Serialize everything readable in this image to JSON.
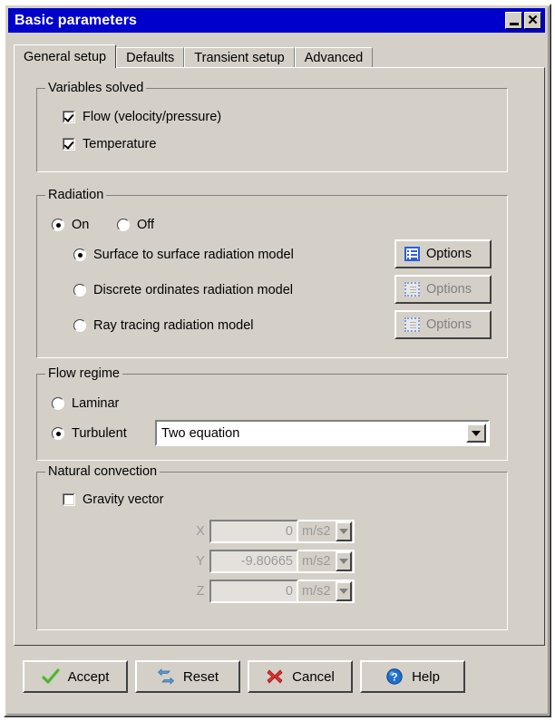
{
  "window": {
    "title": "Basic parameters",
    "minimize_label": "Minimize",
    "close_label": "Close",
    "minimize_icon": "minimize-icon",
    "close_icon": "close-icon",
    "titlebar_color": "#0000cc",
    "face_color": "#d4d0c8"
  },
  "tabs": [
    {
      "label": "General setup",
      "active": true
    },
    {
      "label": "Defaults",
      "active": false
    },
    {
      "label": "Transient setup",
      "active": false
    },
    {
      "label": "Advanced",
      "active": false
    }
  ],
  "variables_solved": {
    "legend": "Variables solved",
    "items": [
      {
        "label": "Flow (velocity/pressure)",
        "checked": true
      },
      {
        "label": "Temperature",
        "checked": true
      }
    ]
  },
  "radiation": {
    "legend": "Radiation",
    "toggle": [
      {
        "label": "On",
        "selected": true
      },
      {
        "label": "Off",
        "selected": false
      }
    ],
    "models": [
      {
        "label": "Surface to surface radiation model",
        "selected": true,
        "options_label": "Options",
        "options_enabled": true,
        "options_icon": "list-options-icon"
      },
      {
        "label": "Discrete ordinates radiation model",
        "selected": false,
        "options_label": "Options",
        "options_enabled": false,
        "options_icon": "grid-options-icon"
      },
      {
        "label": "Ray tracing radiation model",
        "selected": false,
        "options_label": "Options",
        "options_enabled": false,
        "options_icon": "grid-options-icon"
      }
    ]
  },
  "flow_regime": {
    "legend": "Flow regime",
    "options": [
      {
        "label": "Laminar",
        "selected": false
      },
      {
        "label": "Turbulent",
        "selected": true
      }
    ],
    "turbulence_model": {
      "value": "Two equation",
      "arrow_icon": "chevron-down-icon"
    }
  },
  "natural_convection": {
    "legend": "Natural convection",
    "gravity_vector": {
      "label": "Gravity vector",
      "checked": false
    },
    "components": [
      {
        "axis": "X",
        "value": "0",
        "unit": "m/s2",
        "enabled": false
      },
      {
        "axis": "Y",
        "value": "-9.80665",
        "unit": "m/s2",
        "enabled": false
      },
      {
        "axis": "Z",
        "value": "0",
        "unit": "m/s2",
        "enabled": false
      }
    ]
  },
  "actions": [
    {
      "label": "Accept",
      "icon": "green-check-icon"
    },
    {
      "label": "Reset",
      "icon": "blue-refresh-icon"
    },
    {
      "label": "Cancel",
      "icon": "red-x-icon"
    },
    {
      "label": "Help",
      "icon": "blue-question-icon"
    }
  ]
}
